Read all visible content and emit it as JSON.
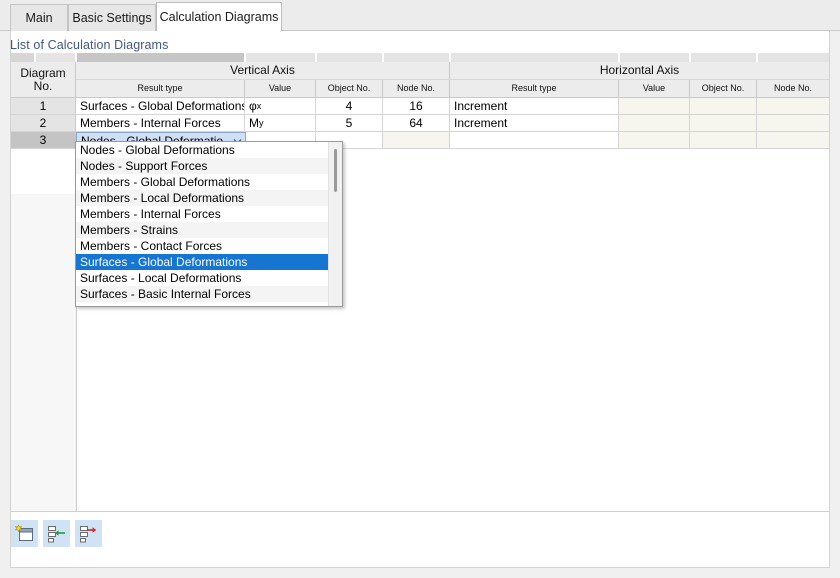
{
  "window": {
    "background_color": "#cfd0d4",
    "panel_color": "#ffffff"
  },
  "tabs": [
    {
      "label": "Main",
      "active": false
    },
    {
      "label": "Basic Settings",
      "active": false
    },
    {
      "label": "Calculation Diagrams",
      "active": true
    }
  ],
  "section": {
    "title": "List of Calculation Diagrams",
    "title_color": "#3f5a80"
  },
  "table": {
    "index_header_line1": "Diagram",
    "index_header_line2": "No.",
    "groups": [
      {
        "label": "Vertical Axis"
      },
      {
        "label": "Horizontal Axis"
      }
    ],
    "subheaders": {
      "result_type": "Result type",
      "value": "Value",
      "object_no": "Object No.",
      "node_no": "Node No."
    },
    "rows": [
      {
        "no": "1",
        "v_result_type": "Surfaces - Global Deformations",
        "v_value_base": "φ",
        "v_value_sub": "x",
        "v_object_no": "4",
        "v_node_no": "16",
        "h_result_type": "Increment",
        "h_value": "",
        "h_object_no": "",
        "h_node_no": "",
        "selected": false,
        "editing": false
      },
      {
        "no": "2",
        "v_result_type": "Members - Internal Forces",
        "v_value_base": "M",
        "v_value_sub": "y",
        "v_object_no": "5",
        "v_node_no": "64",
        "h_result_type": "Increment",
        "h_value": "",
        "h_object_no": "",
        "h_node_no": "",
        "selected": false,
        "editing": false
      },
      {
        "no": "3",
        "v_result_type": "Nodes - Global Deformatio...",
        "v_value_base": "",
        "v_value_sub": "",
        "v_object_no": "",
        "v_node_no": "",
        "h_result_type": "",
        "h_value": "",
        "h_object_no": "",
        "h_node_no": "",
        "selected": true,
        "editing": true
      }
    ]
  },
  "dropdown": {
    "open": true,
    "highlight_color": "#1675d1",
    "selected_item": "Surfaces - Global Deformations",
    "items": [
      "Nodes - Global Deformations",
      "Nodes - Support Forces",
      "Members - Global Deformations",
      "Members - Local Deformations",
      "Members - Internal Forces",
      "Members - Strains",
      "Members - Contact Forces",
      "Surfaces - Global Deformations",
      "Surfaces - Local Deformations",
      "Surfaces - Basic Internal Forces"
    ]
  },
  "toolbar": {
    "buttons": [
      {
        "name": "new-row-button",
        "icon": "new-window-icon",
        "title": "New"
      },
      {
        "name": "insert-row-button",
        "icon": "insert-row-icon",
        "title": "Insert Row"
      },
      {
        "name": "delete-row-button",
        "icon": "delete-row-icon",
        "title": "Delete Row"
      }
    ]
  }
}
